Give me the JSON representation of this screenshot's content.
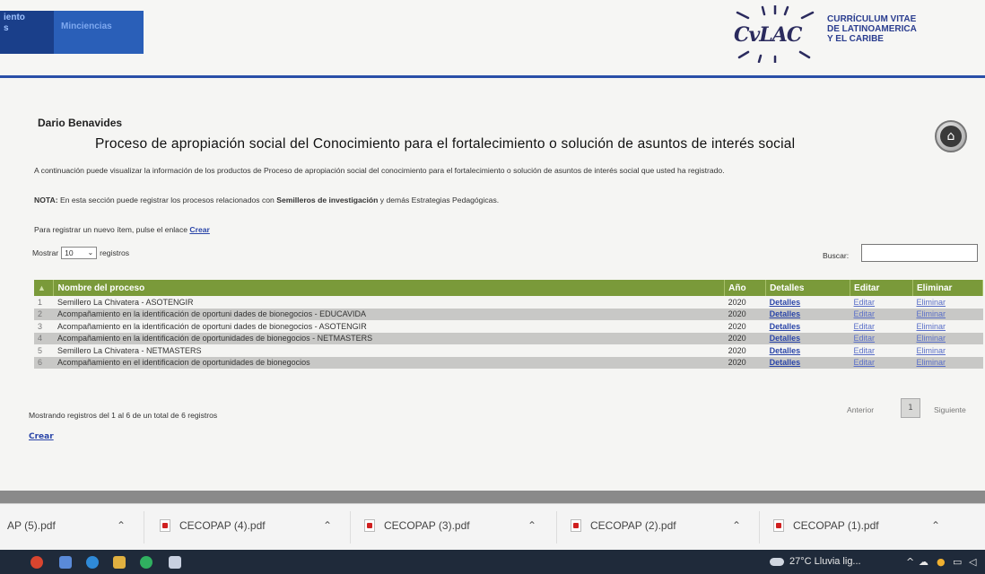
{
  "nav": {
    "tab1_line1": "iento",
    "tab1_line2": "s",
    "tab2": "Minciencias"
  },
  "logo": {
    "word": "CvLAC",
    "tag_line1": "CURRÍCULUM VITAE",
    "tag_line2": "DE LATINOAMERICA",
    "tag_line3": "Y EL CARIBE"
  },
  "user_name": "Dario Benavides",
  "page_title": "Proceso de apropiación social del Conocimiento para el fortalecimiento o solución de asuntos de interés social",
  "intro": "A continuación puede visualizar la información de los productos de Proceso de apropiación social del conocimiento para el fortalecimiento o solución de asuntos de interés social que usted ha registrado.",
  "nota": {
    "label": "NOTA:",
    "text_before": " En esta sección puede registrar los procesos relacionados con ",
    "bold": "Semilleros de investigación",
    "text_after": " y demás Estrategias Pedagógicas."
  },
  "register": {
    "text": "Para registrar un nuevo ítem, pulse el enlace ",
    "link": "Crear"
  },
  "mostrar": {
    "label_before": "Mostrar",
    "value": "10",
    "label_after": "registros"
  },
  "buscar_label": "Buscar:",
  "table": {
    "headers": {
      "sort": "▲",
      "name": "Nombre del proceso",
      "year": "Año",
      "details": "Detalles",
      "edit": "Editar",
      "delete": "Eliminar"
    },
    "rows": [
      {
        "n": "1",
        "name": "Semillero La Chivatera - ASOTENGIR",
        "year": "2020",
        "details": "Detalles",
        "edit": "Editar",
        "delete": "Eliminar"
      },
      {
        "n": "2",
        "name": "Acompañamiento en la identificación de oportuni dades de bionegocios - EDUCAVIDA",
        "year": "2020",
        "details": "Detalles",
        "edit": "Editar",
        "delete": "Eliminar"
      },
      {
        "n": "3",
        "name": "Acompañamiento en la identificación de oportuni dades de bionegocios - ASOTENGIR",
        "year": "2020",
        "details": "Detalles",
        "edit": "Editar",
        "delete": "Eliminar"
      },
      {
        "n": "4",
        "name": "Acompañamiento en la identificación de oportunidades de bionegocios - NETMASTERS",
        "year": "2020",
        "details": "Detalles",
        "edit": "Editar",
        "delete": "Eliminar"
      },
      {
        "n": "5",
        "name": "Semillero La Chivatera - NETMASTERS",
        "year": "2020",
        "details": "Detalles",
        "edit": "Editar",
        "delete": "Eliminar"
      },
      {
        "n": "6",
        "name": "Acompañamiento en el identificacion de oportunidades de bionegocios",
        "year": "2020",
        "details": "Detalles",
        "edit": "Editar",
        "delete": "Eliminar"
      }
    ]
  },
  "mostrando": "Mostrando registros del 1 al 6 de un total de 6 registros",
  "crear_bottom": "Crear",
  "pager": {
    "prev": "Anterior",
    "current": "1",
    "next": "Siguiente"
  },
  "downloads": [
    {
      "name": "AP (5).pdf"
    },
    {
      "name": "CECOPAP (4).pdf"
    },
    {
      "name": "CECOPAP (3).pdf"
    },
    {
      "name": "CECOPAP (2).pdf"
    },
    {
      "name": "CECOPAP (1).pdf"
    }
  ],
  "taskbar": {
    "weather": "27°C  Lluvia lig..."
  },
  "colors": {
    "table_header": "#7a9a3a",
    "link": "#2a45a8",
    "header_line": "#2a4fa8"
  }
}
